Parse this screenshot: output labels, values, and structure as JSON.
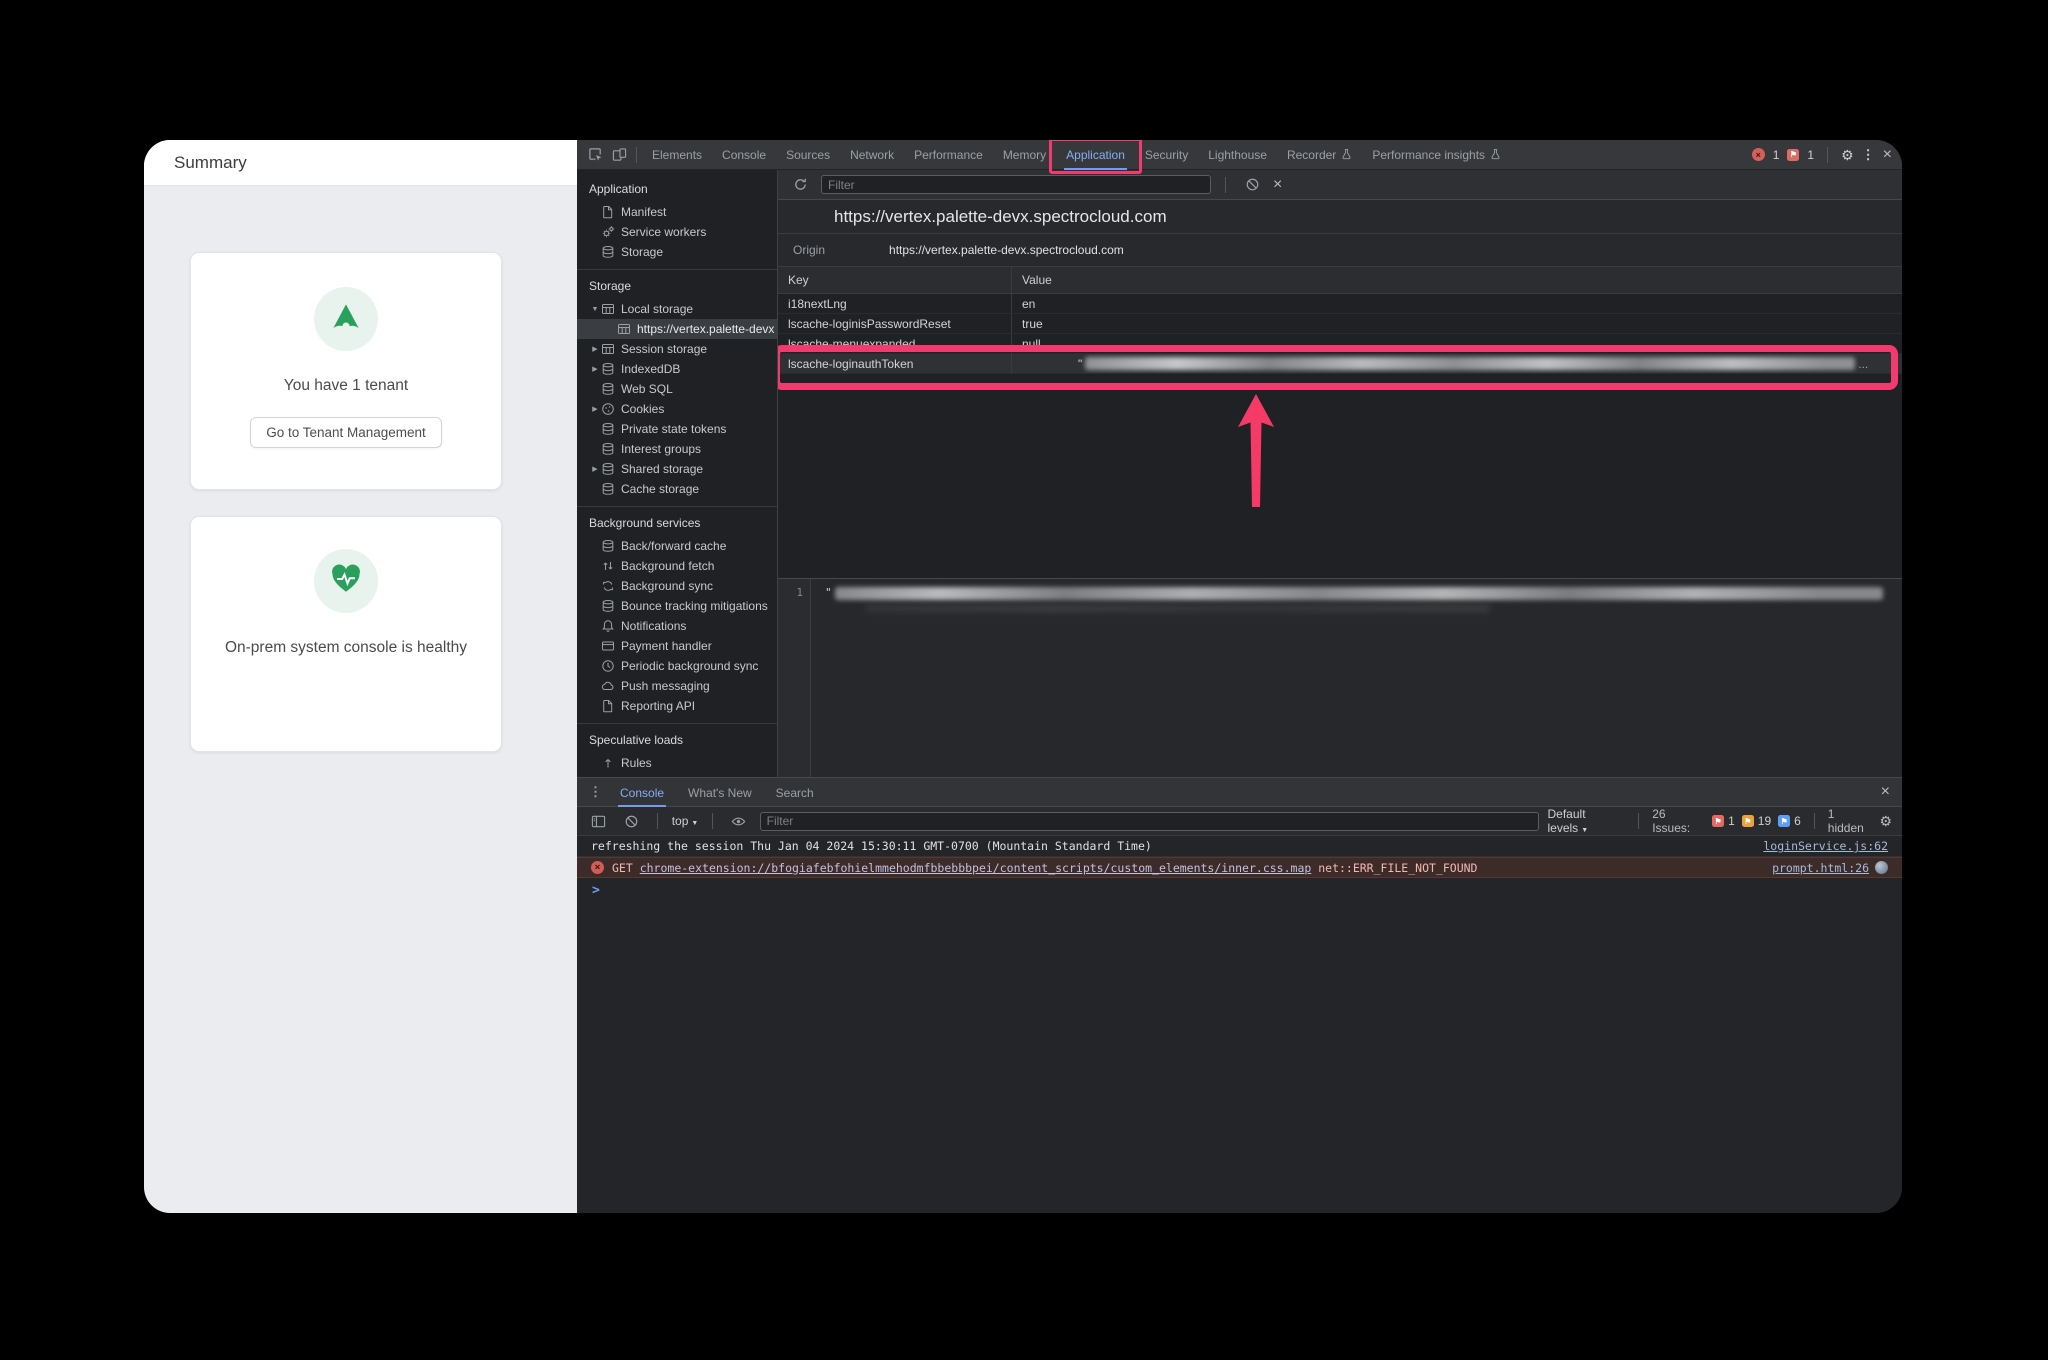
{
  "annotations": {
    "highlight_color": "#f13b6f"
  },
  "page": {
    "header_title": "Summary",
    "tenant_card": {
      "message": "You have 1 tenant",
      "button_label": "Go to Tenant Management",
      "accent_color": "#2ba05e"
    },
    "health_card": {
      "message": "On-prem system console is healthy"
    }
  },
  "devtools": {
    "tabs": [
      {
        "label": "Elements"
      },
      {
        "label": "Console"
      },
      {
        "label": "Sources"
      },
      {
        "label": "Network"
      },
      {
        "label": "Performance"
      },
      {
        "label": "Memory"
      },
      {
        "label": "Application",
        "selected": true,
        "annotated": true
      },
      {
        "label": "Security"
      },
      {
        "label": "Lighthouse"
      },
      {
        "label": "Recorder",
        "flask": true
      },
      {
        "label": "Performance insights",
        "flask": true
      }
    ],
    "top_right": {
      "error_count": "1",
      "issue_count": "1"
    },
    "sidebar": {
      "sections": [
        {
          "title": "Application",
          "items": [
            {
              "label": "Manifest",
              "icon": "file-icon"
            },
            {
              "label": "Service workers",
              "icon": "service-workers-icon"
            },
            {
              "label": "Storage",
              "icon": "database-icon"
            }
          ]
        },
        {
          "title": "Storage",
          "items": [
            {
              "label": "Local storage",
              "icon": "table-icon",
              "expander": "open"
            },
            {
              "label": "https://vertex.palette-devx",
              "icon": "table-icon",
              "child": true,
              "selected": true
            },
            {
              "label": "Session storage",
              "icon": "table-icon",
              "expander": "closed"
            },
            {
              "label": "IndexedDB",
              "icon": "database-icon",
              "expander": "closed"
            },
            {
              "label": "Web SQL",
              "icon": "database-icon"
            },
            {
              "label": "Cookies",
              "icon": "cookie-icon",
              "expander": "closed"
            },
            {
              "label": "Private state tokens",
              "icon": "database-icon"
            },
            {
              "label": "Interest groups",
              "icon": "database-icon"
            },
            {
              "label": "Shared storage",
              "icon": "database-icon",
              "expander": "closed"
            },
            {
              "label": "Cache storage",
              "icon": "database-icon"
            }
          ]
        },
        {
          "title": "Background services",
          "items": [
            {
              "label": "Back/forward cache",
              "icon": "database-icon"
            },
            {
              "label": "Background fetch",
              "icon": "fetch-icon"
            },
            {
              "label": "Background sync",
              "icon": "sync-icon"
            },
            {
              "label": "Bounce tracking mitigations",
              "icon": "database-icon"
            },
            {
              "label": "Notifications",
              "icon": "bell-icon"
            },
            {
              "label": "Payment handler",
              "icon": "card-icon"
            },
            {
              "label": "Periodic background sync",
              "icon": "clock-icon"
            },
            {
              "label": "Push messaging",
              "icon": "cloud-icon"
            },
            {
              "label": "Reporting API",
              "icon": "file-icon"
            }
          ]
        },
        {
          "title": "Speculative loads",
          "items": [
            {
              "label": "Rules",
              "icon": "rules-icon"
            }
          ]
        }
      ]
    },
    "storage": {
      "filter_placeholder": "Filter",
      "url_title": "https://vertex.palette-devx.spectrocloud.com",
      "origin_label": "Origin",
      "origin_value": "https://vertex.palette-devx.spectrocloud.com",
      "key_header": "Key",
      "value_header": "Value",
      "rows": [
        {
          "key": "i18nextLng",
          "value": "en"
        },
        {
          "key": "lscache-loginisPasswordReset",
          "value": "true"
        },
        {
          "key": "lscache-menuexpanded",
          "value": "null"
        },
        {
          "key": "lscache-loginauthToken",
          "value": "\"",
          "redacted": true
        }
      ],
      "redacted_ellipsis": "...",
      "preview_line_number": "1",
      "preview_open_quote": "\""
    },
    "console": {
      "tabs": [
        "Console",
        "What's New",
        "Search"
      ],
      "selected_tab": "Console",
      "context_label": "top",
      "filter_placeholder": "Filter",
      "levels_label": "Default levels",
      "issues_label": "26 Issues:",
      "issue_badges": [
        {
          "count": "1",
          "color": "#e46962"
        },
        {
          "count": "19",
          "color": "#e8a33d"
        },
        {
          "count": "6",
          "color": "#5f9df5"
        }
      ],
      "hidden_label": "1 hidden",
      "messages": [
        {
          "level": "log",
          "parts": [
            {
              "text": "refreshing the session Thu Jan 04 2024 15:30:11 GMT-0700 (Mountain Standard Time)"
            }
          ],
          "source": "loginService.js:62"
        },
        {
          "level": "error",
          "parts": [
            {
              "text": "GET "
            },
            {
              "text": "chrome-extension://bfogiafebfohielmmehodmfbbebbbpei/content_scripts/custom_elements/inner.css.map",
              "link": true
            },
            {
              "text": " net::ERR_FILE_NOT_FOUND"
            }
          ],
          "source": "prompt.html:26",
          "source_icon": true
        }
      ],
      "prompt_char": ">"
    }
  }
}
